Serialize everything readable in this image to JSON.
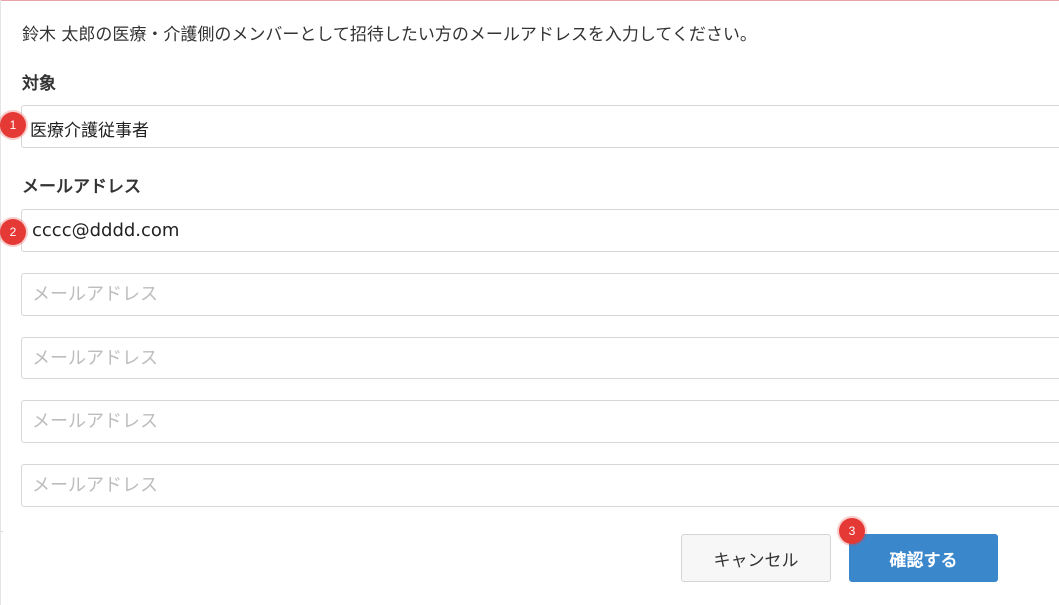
{
  "instruction": "鈴木 太郎の医療・介護側のメンバーとして招待したい方のメールアドレスを入力してください。",
  "target": {
    "label": "対象",
    "value": "医療介護従事者"
  },
  "email": {
    "label": "メールアドレス",
    "fields": [
      {
        "value": "cccc@dddd.com",
        "placeholder": "メールアドレス"
      },
      {
        "value": "",
        "placeholder": "メールアドレス"
      },
      {
        "value": "",
        "placeholder": "メールアドレス"
      },
      {
        "value": "",
        "placeholder": "メールアドレス"
      },
      {
        "value": "",
        "placeholder": "メールアドレス"
      }
    ]
  },
  "markers": [
    "1",
    "2",
    "3"
  ],
  "buttons": {
    "cancel": "キャンセル",
    "confirm": "確認する"
  },
  "colors": {
    "marker": "#e53935",
    "confirm_button": "#3b87cc",
    "top_border": "#e7a5a9"
  }
}
